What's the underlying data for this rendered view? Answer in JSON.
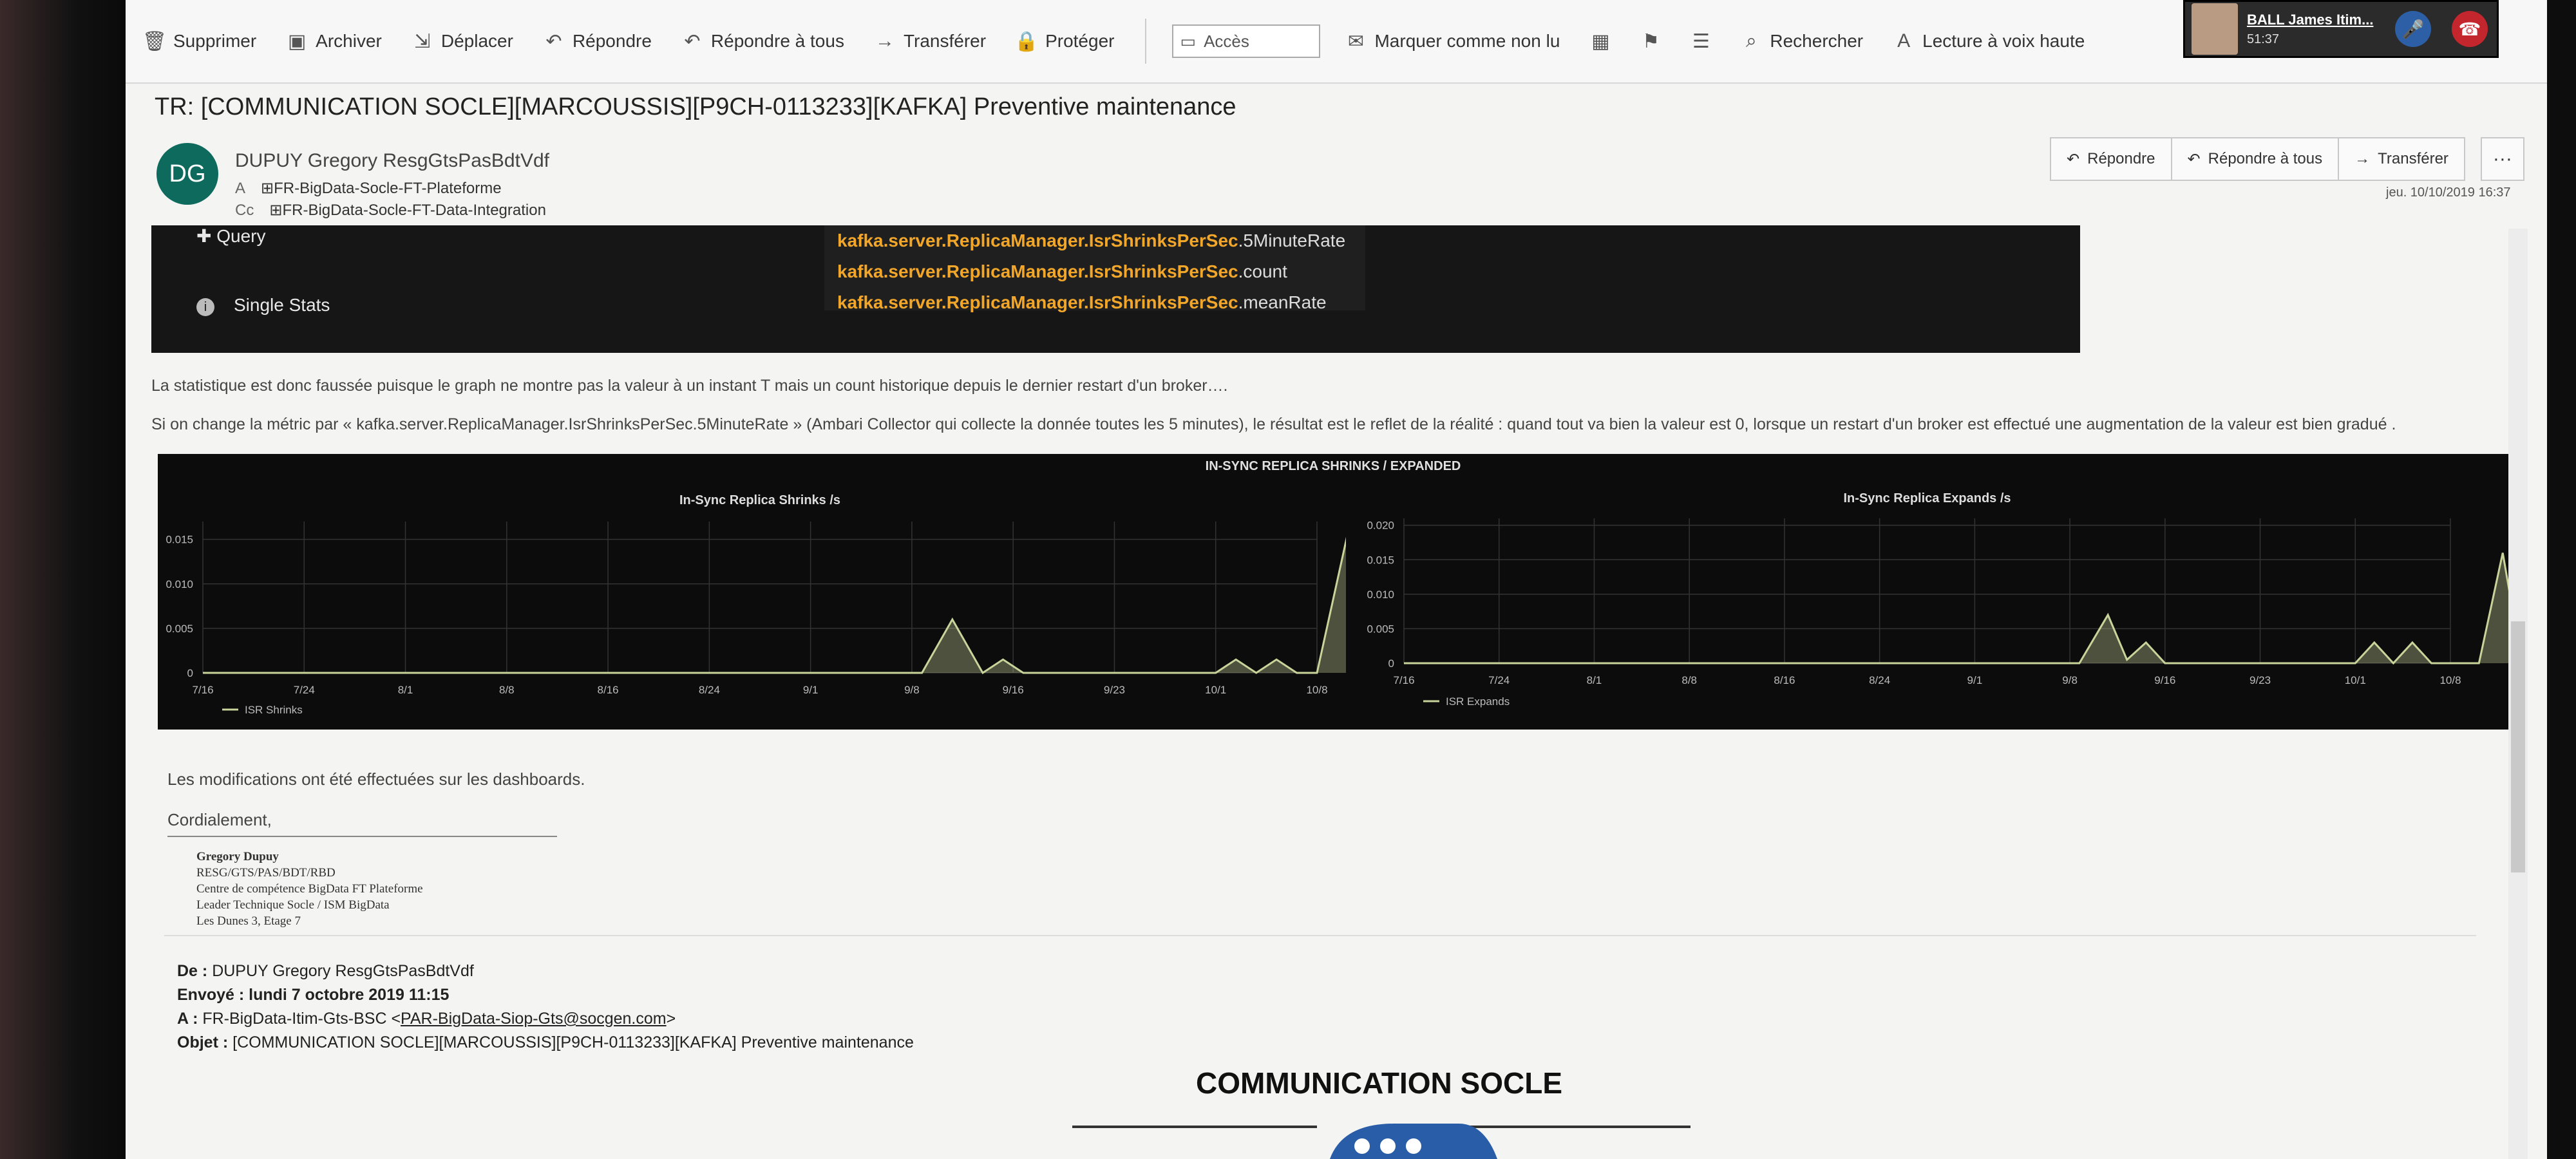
{
  "ribbon": {
    "items": [
      {
        "label": "Supprimer",
        "icon": "trash-icon"
      },
      {
        "label": "Archiver",
        "icon": "archive-icon"
      },
      {
        "label": "Déplacer",
        "icon": "move-icon"
      },
      {
        "label": "Répondre",
        "icon": "reply-icon"
      },
      {
        "label": "Répondre à tous",
        "icon": "reply-all-icon"
      },
      {
        "label": "Transférer",
        "icon": "forward-icon"
      },
      {
        "label": "Protéger",
        "icon": "lock-icon"
      }
    ],
    "acces": "Accès",
    "items2": [
      {
        "label": "Marquer comme non lu",
        "icon": "envelope-icon"
      },
      {
        "label": "",
        "icon": "categorize-icon"
      },
      {
        "label": "",
        "icon": "flag-icon"
      },
      {
        "label": "",
        "icon": "rules-icon"
      },
      {
        "label": "Rechercher",
        "icon": "search-icon"
      },
      {
        "label": "Lecture à voix haute",
        "icon": "read-aloud-icon"
      }
    ]
  },
  "call": {
    "name": "BALL James Itim...",
    "time": "51:37"
  },
  "email": {
    "subject": "TR: [COMMUNICATION SOCLE][MARCOUSSIS][P9CH-0113233][KAFKA] Preventive maintenance",
    "avatar_initials": "DG",
    "sender": "DUPUY Gregory ResgGtsPasBdtVdf",
    "to_label": "A",
    "to": "FR-BigData-Socle-FT-Plateforme",
    "cc_label": "Cc",
    "cc": "FR-BigData-Socle-FT-Data-Integration",
    "actions": [
      "Répondre",
      "Répondre à tous",
      "Transférer"
    ],
    "more": "···",
    "date": "jeu. 10/10/2019 16:37"
  },
  "grafana": {
    "query": "Query",
    "single_stats": "Single Stats",
    "suggestions": [
      {
        "bold": "kafka.server.ReplicaManager.IsrShrinksPerSec",
        "rest": ".5MinuteRate"
      },
      {
        "bold": "kafka.server.ReplicaManager.IsrShrinksPerSec",
        "rest": ".count"
      },
      {
        "bold": "kafka.server.ReplicaManager.IsrShrinksPerSec",
        "rest": ".meanRate"
      }
    ]
  },
  "body": {
    "p1": "La statistique est donc faussée puisque le graph ne montre pas la valeur à un instant T mais un count historique depuis le dernier restart d'un broker….",
    "p2": "Si on change la métric par « kafka.server.ReplicaManager.IsrShrinksPerSec.5MinuteRate » (Ambari Collector qui collecte la donnée toutes les 5 minutes), le résultat est le reflet de la réalité : quand tout va bien la valeur est 0, lorsque un restart d'un broker est effectué une augmentation de la valeur est bien gradué .",
    "mods": "Les modifications ont été effectuées sur les dashboards.",
    "cordial": "Cordialement,",
    "signature": [
      "Gregory Dupuy",
      "RESG/GTS/PAS/BDT/RBD",
      "Centre de compétence BigData FT Plateforme",
      "Leader Technique Socle / ISM BigData",
      "Les Dunes 3, Etage 7"
    ]
  },
  "forward": {
    "de_label": "De :",
    "de": "DUPUY Gregory ResgGtsPasBdtVdf",
    "envoye_label": "Envoyé :",
    "envoye": "lundi 7 octobre 2019 11:15",
    "a_label": "A :",
    "a": "FR-BigData-Itim-Gts-BSC <",
    "a_link": "PAR-BigData-Siop-Gts@socgen.com",
    "a_end": ">",
    "objet_label": "Objet :",
    "objet": "[COMMUNICATION SOCLE][MARCOUSSIS][P9CH-0113233][KAFKA] Preventive maintenance",
    "heading": "COMMUNICATION SOCLE"
  },
  "chart_data": [
    {
      "type": "area",
      "panel_title": "IN-SYNC REPLICA SHRINKS / EXPANDED",
      "title": "In-Sync Replica Shrinks /s",
      "x_ticks": [
        "7/16",
        "7/24",
        "8/1",
        "8/8",
        "8/16",
        "8/24",
        "9/1",
        "9/8",
        "9/16",
        "9/23",
        "10/1",
        "10/8"
      ],
      "y_ticks": [
        "0",
        "0.005",
        "0.010",
        "0.015"
      ],
      "ylim": [
        0,
        0.017
      ],
      "series": [
        {
          "name": "ISR Shrinks",
          "x": [
            0,
            7.1,
            7.4,
            7.7,
            7.9,
            8.1,
            8.3,
            10.0,
            10.2,
            10.4,
            10.6,
            10.8,
            11.0,
            11.3,
            11.5,
            11.7,
            12.0
          ],
          "values": [
            0,
            0,
            0.006,
            0,
            0.0015,
            0,
            0,
            0,
            0.0015,
            0,
            0.0015,
            0,
            0,
            0.0155,
            0,
            0,
            0
          ]
        }
      ],
      "color": "#c9d49a"
    },
    {
      "type": "area",
      "title": "In-Sync Replica Expands /s",
      "x_ticks": [
        "7/16",
        "7/24",
        "8/1",
        "8/8",
        "8/16",
        "8/24",
        "9/1",
        "9/8",
        "9/16",
        "9/23",
        "10/1",
        "10/8"
      ],
      "y_ticks": [
        "0",
        "0.005",
        "0.010",
        "0.015",
        "0.020"
      ],
      "ylim": [
        0,
        0.021
      ],
      "series": [
        {
          "name": "ISR Expands",
          "x": [
            0,
            7.1,
            7.4,
            7.6,
            7.8,
            8.0,
            10.0,
            10.2,
            10.4,
            10.6,
            10.8,
            11.0,
            11.3,
            11.55,
            11.75,
            12.0
          ],
          "values": [
            0,
            0,
            0.007,
            0.0005,
            0.003,
            0,
            0,
            0.003,
            0,
            0.003,
            0,
            0,
            0,
            0.016,
            0,
            0
          ]
        }
      ],
      "color": "#c9d49a"
    }
  ]
}
